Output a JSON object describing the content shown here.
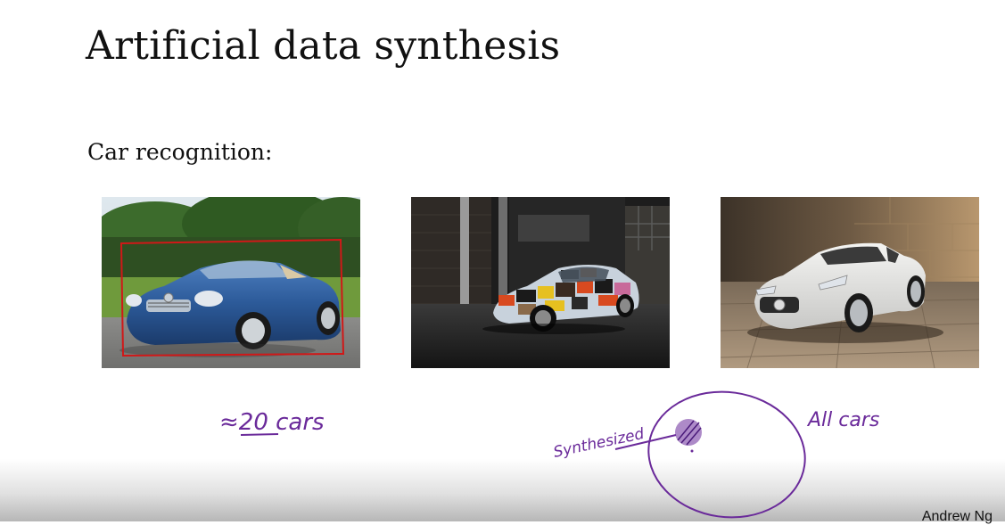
{
  "slide": {
    "title": "Artificial data synthesis",
    "subtitle": "Car recognition:",
    "author": "Andrew Ng"
  },
  "images": [
    {
      "name": "blue convertible car photo",
      "icon": "car-photo"
    },
    {
      "name": "camouflage wrapped car photo",
      "icon": "car-photo"
    },
    {
      "name": "white sports car photo",
      "icon": "car-photo"
    }
  ],
  "annotations": {
    "count_note": "≈20 cars",
    "synthesized_label": "Synthesized",
    "all_cars_label": "All cars",
    "ink_color": "#6a2a9a",
    "box_color": "#d01818"
  }
}
